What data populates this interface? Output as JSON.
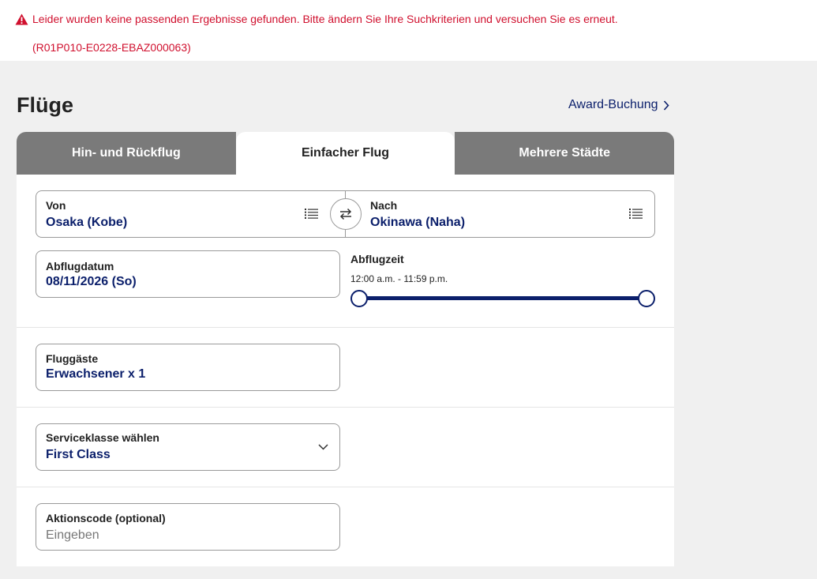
{
  "error": {
    "message": "Leider wurden keine passenden Ergebnisse gefunden. Bitte ändern Sie Ihre Suchkriterien und versuchen Sie es erneut.",
    "code": "(R01P010-E0228-EBAZ000063)",
    "icon": "warning-icon",
    "color": "#d0102e"
  },
  "header": {
    "title": "Flüge",
    "award_link": "Award-Buchung"
  },
  "tabs": [
    {
      "label": "Hin- und Rückflug",
      "active": false
    },
    {
      "label": "Einfacher Flug",
      "active": true
    },
    {
      "label": "Mehrere Städte",
      "active": false
    }
  ],
  "route": {
    "from_label": "Von",
    "from_value": "Osaka (Kobe)",
    "to_label": "Nach",
    "to_value": "Okinawa (Naha)"
  },
  "departure": {
    "date_label": "Abflugdatum",
    "date_value": "08/11/2026 (So)",
    "time_label": "Abflugzeit",
    "time_range": "12:00 a.m. - 11:59 p.m."
  },
  "passengers": {
    "label": "Fluggäste",
    "value": "Erwachsener x 1"
  },
  "cabin": {
    "label": "Serviceklasse wählen",
    "value": "First Class"
  },
  "promo": {
    "label": "Aktionscode (optional)",
    "placeholder": "Eingeben"
  },
  "colors": {
    "accent": "#0b1f6b",
    "tab_inactive": "#7a7a7a",
    "error": "#d0102e"
  }
}
